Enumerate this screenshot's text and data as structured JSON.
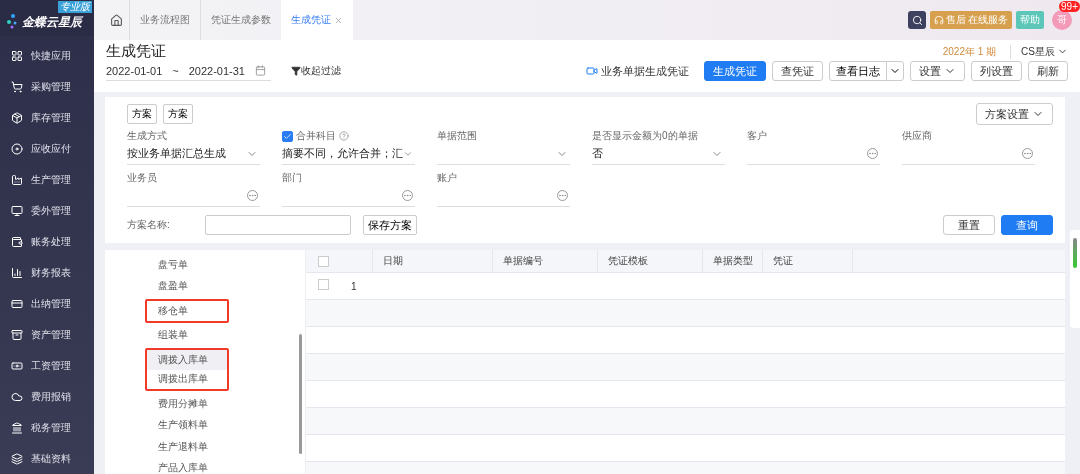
{
  "brand": {
    "name": "金蝶云星辰",
    "edition": "专业版"
  },
  "sidebar": {
    "items": [
      {
        "label": "快捷应用"
      },
      {
        "label": "采购管理"
      },
      {
        "label": "库存管理"
      },
      {
        "label": "应收应付"
      },
      {
        "label": "生产管理"
      },
      {
        "label": "委外管理"
      },
      {
        "label": "账务处理"
      },
      {
        "label": "财务报表"
      },
      {
        "label": "出纳管理"
      },
      {
        "label": "资产管理"
      },
      {
        "label": "工资管理"
      },
      {
        "label": "费用报销"
      },
      {
        "label": "税务管理"
      },
      {
        "label": "基础资料"
      }
    ]
  },
  "tabs": [
    {
      "label": "业务流程图",
      "selected": false,
      "closable": false
    },
    {
      "label": "凭证生成参数",
      "selected": false,
      "closable": false
    },
    {
      "label": "生成凭证",
      "selected": true,
      "closable": true
    }
  ],
  "topbar": {
    "service_main": "售后",
    "service_sub": "在线服务",
    "help": "帮助",
    "avatar": "哥",
    "badge": "99+"
  },
  "header": {
    "title": "生成凭证",
    "period": "2022年 1 期",
    "org": "CS星辰",
    "date_from": "2022-01-01",
    "date_sep": "~",
    "date_to": "2022-01-31",
    "filter_toggle": "收起过滤"
  },
  "toolbar": [
    {
      "kind": "link",
      "label": "业务单据生成凭证"
    },
    {
      "kind": "primary",
      "label": "生成凭证"
    },
    {
      "kind": "default",
      "label": "查凭证"
    },
    {
      "kind": "split",
      "label": "查看日志"
    },
    {
      "kind": "dropdown",
      "label": "设置"
    },
    {
      "kind": "default",
      "label": "列设置"
    },
    {
      "kind": "default",
      "label": "刷新"
    }
  ],
  "filter": {
    "schemes": [
      "方案",
      "方案"
    ],
    "scheme_settings": "方案设置",
    "fields": [
      {
        "kind": "select",
        "label": "生成方式",
        "value": "按业务单据汇总生成"
      },
      {
        "kind": "select",
        "label": "合并科目",
        "value": "摘要不同，允许合并；汇",
        "checked": true,
        "help": true
      },
      {
        "kind": "select",
        "label": "单据范围"
      },
      {
        "kind": "select",
        "label": "是否显示金额为0的单据",
        "value": "否"
      },
      {
        "kind": "lookup",
        "label": "客户"
      },
      {
        "kind": "lookup",
        "label": "供应商"
      },
      {
        "kind": "lookup",
        "label": "业务员"
      },
      {
        "kind": "lookup",
        "label": "部门"
      },
      {
        "kind": "lookup",
        "label": "账户"
      }
    ],
    "scheme_name_label": "方案名称:",
    "save": "保存方案",
    "reset": "重置",
    "query": "查询"
  },
  "doc_types": [
    {
      "highlighted": false,
      "items": [
        {
          "label": "盘亏单",
          "selected": false
        },
        {
          "label": "盘盈单",
          "selected": false
        }
      ]
    },
    {
      "highlighted": true,
      "items": [
        {
          "label": "移仓单",
          "selected": false
        }
      ]
    },
    {
      "highlighted": false,
      "items": [
        {
          "label": "组装单",
          "selected": false
        }
      ]
    },
    {
      "highlighted": true,
      "items": [
        {
          "label": "调拨入库单",
          "selected": true
        },
        {
          "label": "调拨出库单",
          "selected": false
        }
      ]
    },
    {
      "highlighted": false,
      "items": [
        {
          "label": "费用分摊单",
          "selected": false
        },
        {
          "label": "生产领料单",
          "selected": false
        },
        {
          "label": "生产退料单",
          "selected": false
        },
        {
          "label": "产品入库单",
          "selected": false
        }
      ]
    }
  ],
  "table": {
    "columns": [
      "日期",
      "单据编号",
      "凭证模板",
      "单据类型",
      "凭证"
    ],
    "all_checked": false,
    "rows": [
      {
        "index": "1",
        "checked": false
      }
    ]
  }
}
